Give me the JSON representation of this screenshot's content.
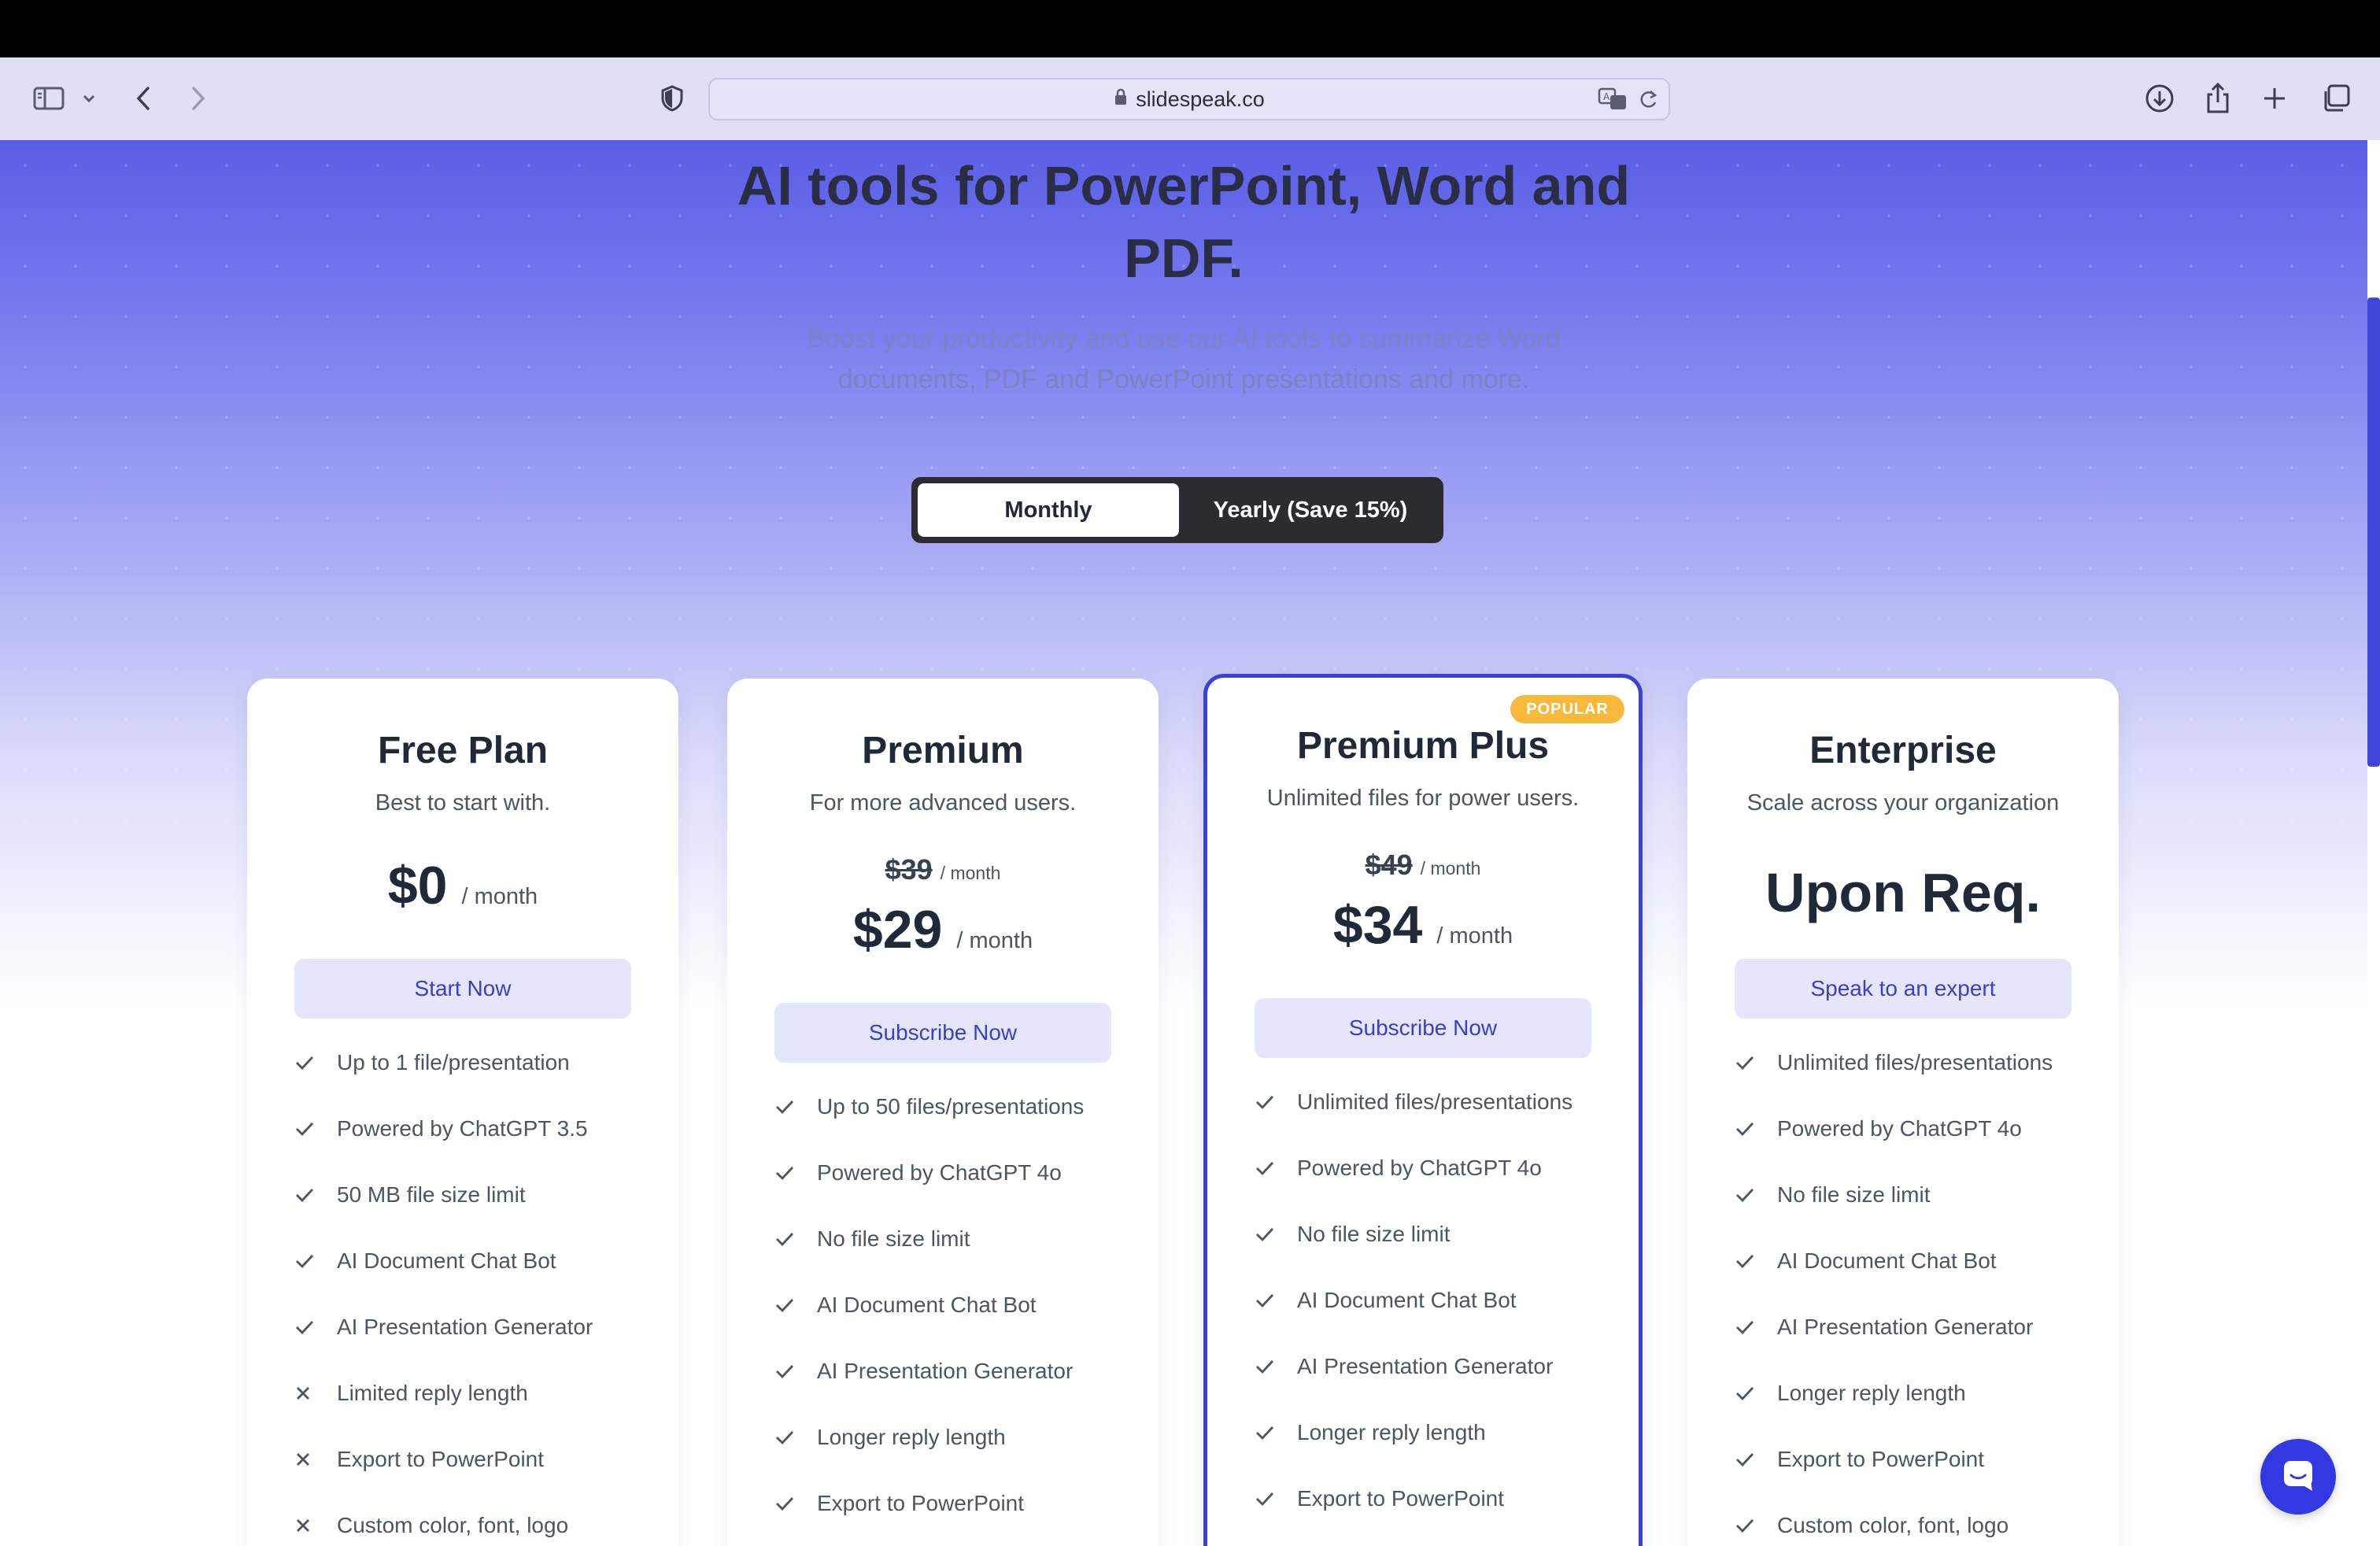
{
  "browser": {
    "url": "slidespeak.co",
    "icons": [
      "sidebar-icon",
      "chevron-down-icon",
      "back-icon",
      "forward-icon",
      "shield-icon",
      "lock-icon",
      "translate-icon",
      "reload-icon",
      "download-icon",
      "share-icon",
      "new-tab-icon",
      "tabs-overview-icon"
    ]
  },
  "hero": {
    "title_line1": "AI tools for PowerPoint, Word and",
    "title_line2": "PDF.",
    "subtitle_line1": "Boost your productivity and use our AI tools to summarize Word",
    "subtitle_line2": "documents, PDF and PowerPoint presentations and more."
  },
  "billing_toggle": {
    "monthly": "Monthly",
    "yearly": "Yearly (Save 15%)",
    "selected": "Monthly"
  },
  "colors": {
    "accent": "#3f3fd6",
    "badge": "#f7b93a",
    "cta_bg": "#e5e6fb",
    "cta_text": "#3a3fc9"
  },
  "plans": [
    {
      "name": "Free Plan",
      "description": "Best to start with.",
      "price": "$0",
      "per": "/ month",
      "cta": "Start Now",
      "features": [
        {
          "text": "Up to 1 file/presentation",
          "included": true
        },
        {
          "text": "Powered by ChatGPT 3.5",
          "included": true
        },
        {
          "text": "50 MB file size limit",
          "included": true
        },
        {
          "text": "AI Document Chat Bot",
          "included": true
        },
        {
          "text": "AI Presentation Generator",
          "included": true
        },
        {
          "text": "Limited reply length",
          "included": false
        },
        {
          "text": "Export to PowerPoint",
          "included": false
        },
        {
          "text": "Custom color, font, logo",
          "included": false
        }
      ]
    },
    {
      "name": "Premium",
      "description": "For more advanced users.",
      "old_price": "$39",
      "old_per": "/ month",
      "price": "$29",
      "per": "/ month",
      "cta": "Subscribe Now",
      "features": [
        {
          "text": "Up to 50 files/presentations",
          "included": true
        },
        {
          "text": "Powered by ChatGPT 4o",
          "included": true
        },
        {
          "text": "No file size limit",
          "included": true
        },
        {
          "text": "AI Document Chat Bot",
          "included": true
        },
        {
          "text": "AI Presentation Generator",
          "included": true
        },
        {
          "text": "Longer reply length",
          "included": true
        },
        {
          "text": "Export to PowerPoint",
          "included": true
        }
      ]
    },
    {
      "name": "Premium Plus",
      "badge": "POPULAR",
      "description": "Unlimited files for power users.",
      "old_price": "$49",
      "old_per": "/ month",
      "price": "$34",
      "per": "/ month",
      "cta": "Subscribe Now",
      "features": [
        {
          "text": "Unlimited files/presentations",
          "included": true
        },
        {
          "text": "Powered by ChatGPT 4o",
          "included": true
        },
        {
          "text": "No file size limit",
          "included": true
        },
        {
          "text": "AI Document Chat Bot",
          "included": true
        },
        {
          "text": "AI Presentation Generator",
          "included": true
        },
        {
          "text": "Longer reply length",
          "included": true
        },
        {
          "text": "Export to PowerPoint",
          "included": true
        }
      ]
    },
    {
      "name": "Enterprise",
      "description": "Scale across your organization",
      "price_text": "Upon Req.",
      "cta": "Speak to an expert",
      "features": [
        {
          "text": "Unlimited files/presentations",
          "included": true
        },
        {
          "text": "Powered by ChatGPT 4o",
          "included": true
        },
        {
          "text": "No file size limit",
          "included": true
        },
        {
          "text": "AI Document Chat Bot",
          "included": true
        },
        {
          "text": "AI Presentation Generator",
          "included": true
        },
        {
          "text": "Longer reply length",
          "included": true
        },
        {
          "text": "Export to PowerPoint",
          "included": true
        },
        {
          "text": "Custom color, font, logo",
          "included": true
        }
      ]
    }
  ]
}
